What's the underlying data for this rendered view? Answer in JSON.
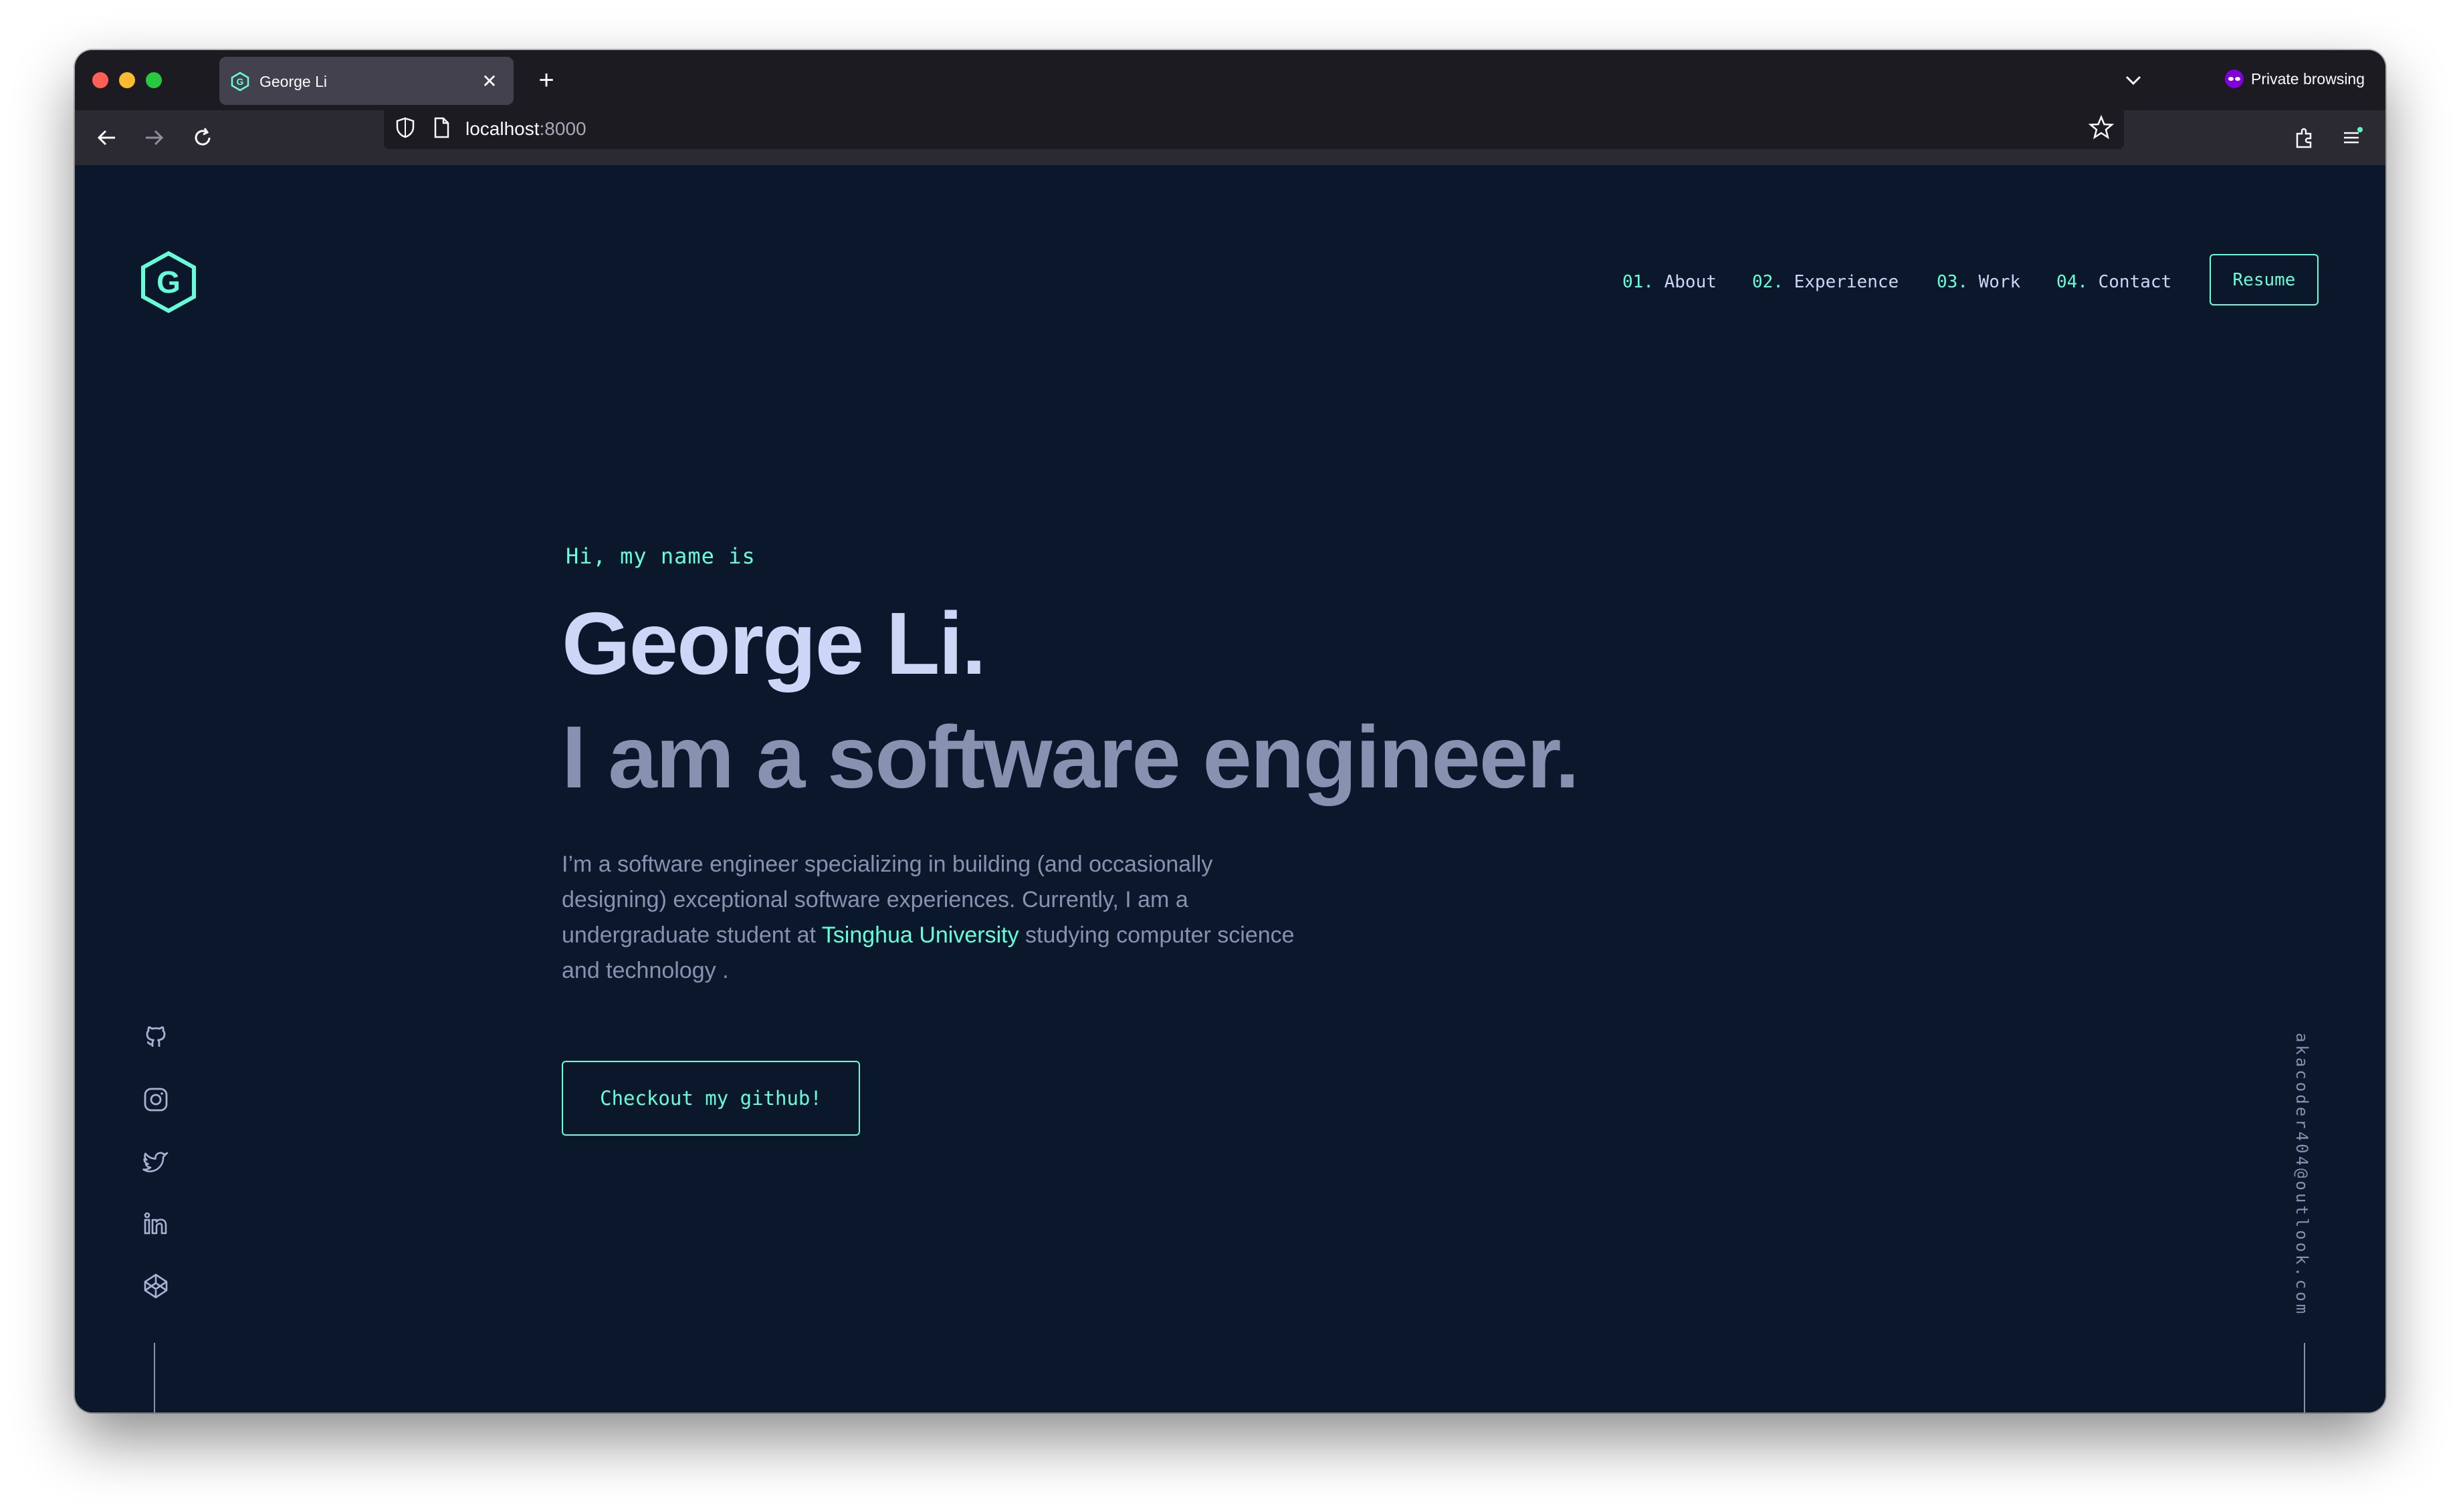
{
  "browser": {
    "tab_title": "George Li",
    "private_label": "Private browsing",
    "url_host": "localhost",
    "url_port": ":8000"
  },
  "nav": {
    "items": [
      {
        "num": "01.",
        "label": "About"
      },
      {
        "num": "02.",
        "label": "Experience"
      },
      {
        "num": "03.",
        "label": "Work"
      },
      {
        "num": "04.",
        "label": "Contact"
      }
    ],
    "resume_label": "Resume"
  },
  "hero": {
    "intro": "Hi, my name is",
    "name": "George Li.",
    "tagline": "I am a software engineer.",
    "desc_part1": "I’m a software engineer specializing in building (and occasionally designing) exceptional software experiences. Currently, I am a undergraduate student at ",
    "desc_link": "Tsinghua University",
    "desc_part2": " studying computer science and technology .",
    "cta_label": "Checkout my github!"
  },
  "sidebar": {
    "socials": [
      "github-icon",
      "instagram-icon",
      "twitter-icon",
      "linkedin-icon",
      "codepen-icon"
    ],
    "email": "akacoder404@outlook.com"
  },
  "colors": {
    "background": "#0b172a",
    "accent": "#64ffda",
    "heading": "#ccd6f6",
    "muted": "#8892b0"
  }
}
